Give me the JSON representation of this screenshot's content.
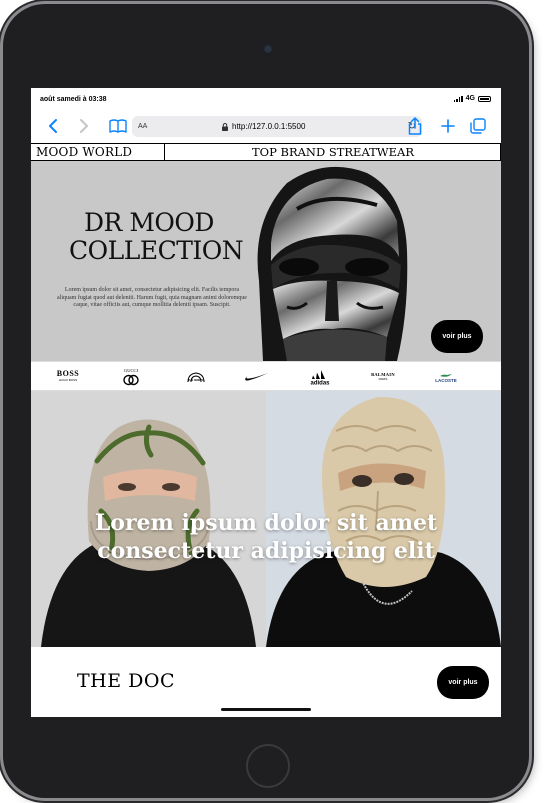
{
  "status_bar": {
    "time": "août samedi à 03:38",
    "network": "4G"
  },
  "browser": {
    "text_size": "AA",
    "url": "http://127.0.0.1:5500"
  },
  "site": {
    "logo": "MOOD WORLD",
    "tagline": "TOP BRAND STREATWEAR"
  },
  "hero": {
    "title_line1": "DR MOOD",
    "title_line2": "COLLECTION",
    "text": "Lorem ipsum dolor sit amet, consectetur adipisicing elit. Facilis tempora aliquam fugiat quod aut deleniti. Harum fugit, quia magnam animi doloremque caque, vitae officiis aut, cumque mollitia deleniti ipsam. Suscipit.",
    "cta": "voir plus"
  },
  "brands": [
    "BOSS",
    "GUCCI",
    "THE NORTH FACE",
    "NIKE",
    "adidas",
    "BALMAIN",
    "LACOSTE"
  ],
  "brand_sublabels": {
    "boss": "HUGO BOSS",
    "balmain": "BALMAIN",
    "balmain_sub": "PARIS"
  },
  "gallery": {
    "overlay_text": "Lorem ipsum dolor sit amet consectetur adipisicing elit"
  },
  "bottom": {
    "title": "THE DOC",
    "cta": "voir plus"
  },
  "colors": {
    "accent": "#0a84ff",
    "hero_bg": "#c8c8c8",
    "button_bg": "#000000"
  }
}
